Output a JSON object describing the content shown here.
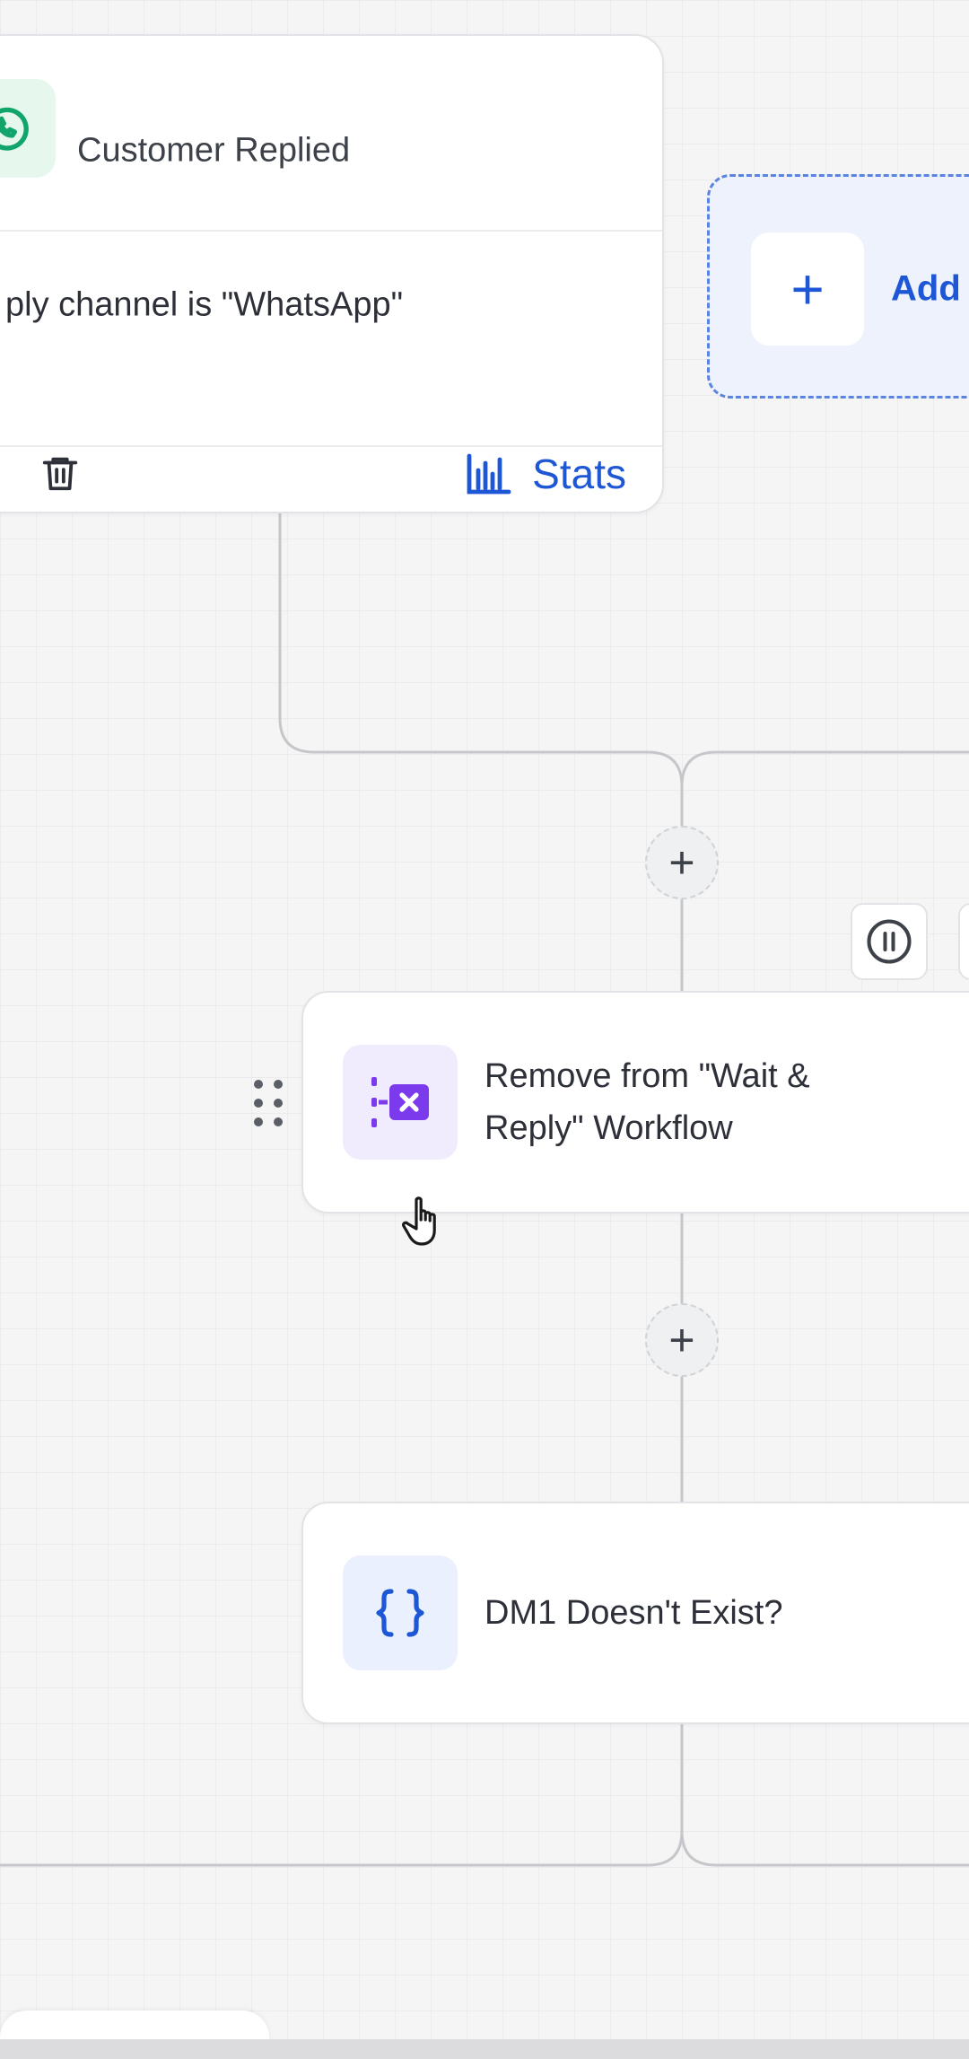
{
  "trigger": {
    "title": "Customer Replied",
    "condition": "ply channel is \"WhatsApp\"",
    "stats_label": "Stats",
    "icon": "whatsapp-icon"
  },
  "add_branch": {
    "label": "Add"
  },
  "actions": [
    {
      "title": "Remove from \"Wait & Reply\" Workflow",
      "icon": "remove-from-workflow-icon"
    },
    {
      "title": "DM1 Doesn't Exist?",
      "icon": "code-braces-icon"
    }
  ],
  "colors": {
    "accent": "#1d57d6",
    "trigger_icon": "#12a56b",
    "remove_icon": "#7c3aed",
    "braces_icon": "#1d57d6",
    "canvas": "#f5f5f6"
  }
}
